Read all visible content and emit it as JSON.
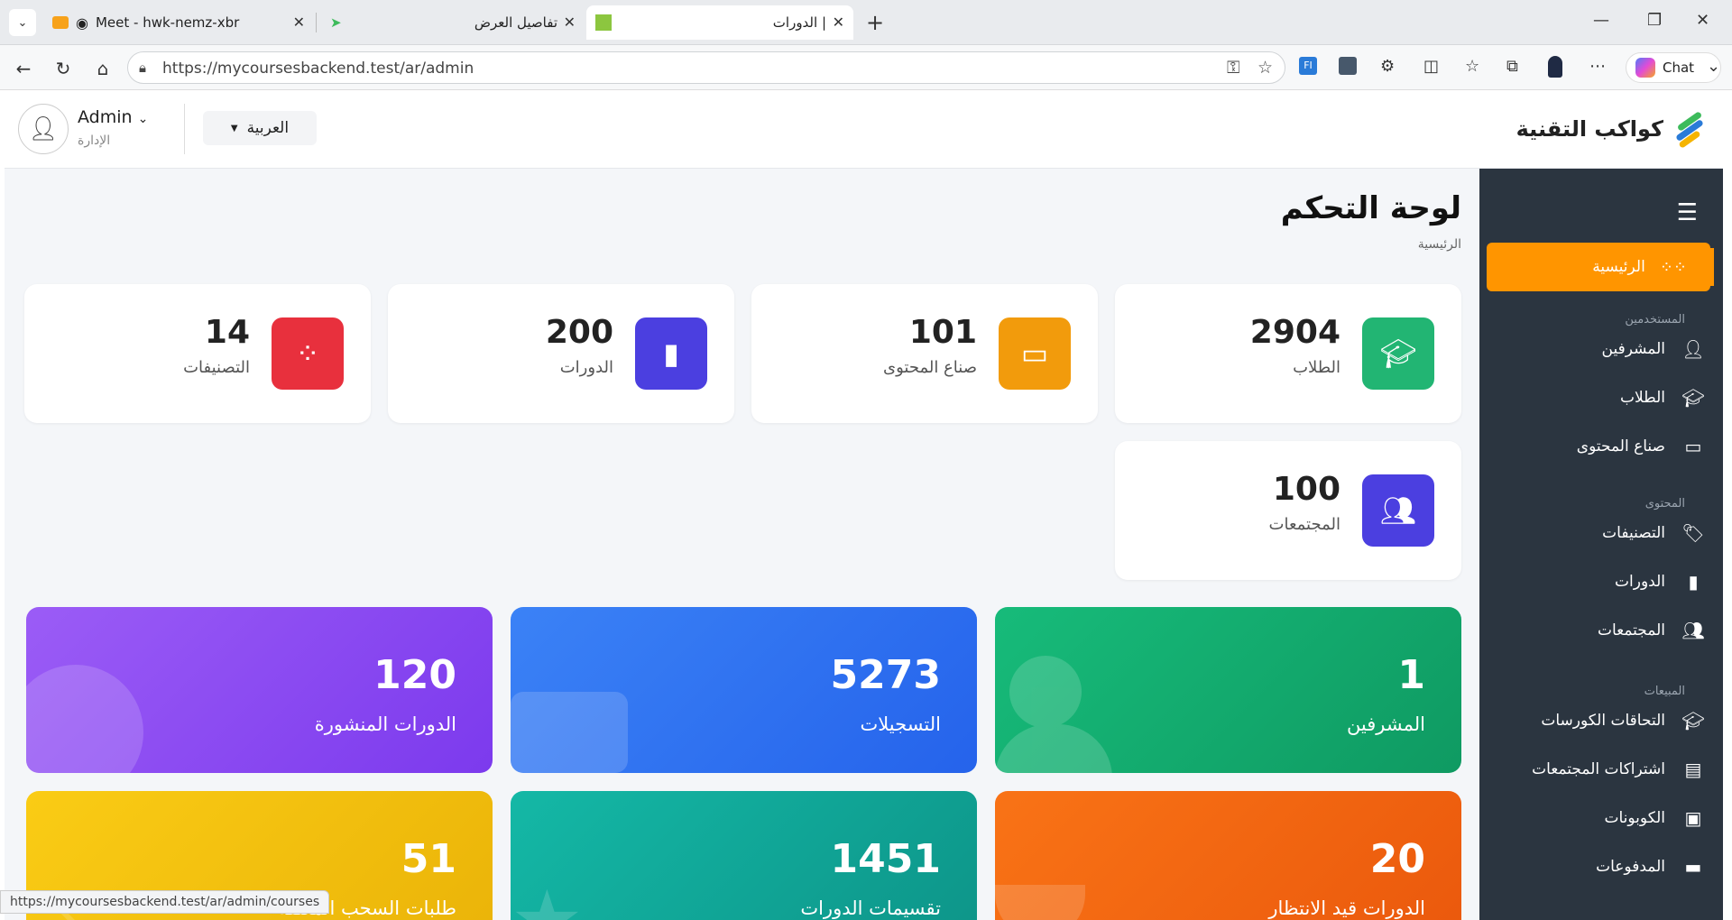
{
  "browser": {
    "tabs": [
      {
        "title": "Meet - hwk-nemz-xbr"
      },
      {
        "title": "تفاصيل العرض"
      },
      {
        "title": "الدورات |"
      }
    ],
    "url": "https://mycoursesbackend.test/ar/admin",
    "chat_label": "Chat",
    "status_url": "https://mycoursesbackend.test/ar/admin/courses"
  },
  "header": {
    "brand": "كواكب التقنية",
    "user_name": "Admin",
    "user_role": "الإدارة",
    "language": "العربية"
  },
  "sidebar": {
    "active": {
      "label": "الرئيسية",
      "icon": "grid-icon"
    },
    "sections": [
      {
        "title": "المستخدمين",
        "items": [
          {
            "label": "المشرفين",
            "icon": "user-shield-icon"
          },
          {
            "label": "الطلاب",
            "icon": "graduate-icon"
          },
          {
            "label": "صناع المحتوى",
            "icon": "teacher-icon"
          }
        ]
      },
      {
        "title": "المحتوى",
        "items": [
          {
            "label": "التصنيفات",
            "icon": "tags-icon"
          },
          {
            "label": "الدورات",
            "icon": "book-icon"
          },
          {
            "label": "المجتمعات",
            "icon": "people-icon"
          }
        ]
      },
      {
        "title": "المبيعات",
        "items": [
          {
            "label": "التحاقات الكورسات",
            "icon": "graduation-cap-icon"
          },
          {
            "label": "اشتراكات المجتمعات",
            "icon": "id-card-icon"
          },
          {
            "label": "الكوبونات",
            "icon": "ticket-icon"
          },
          {
            "label": "المدفوعات",
            "icon": "credit-card-icon"
          }
        ]
      }
    ]
  },
  "main": {
    "title": "لوحة التحكم",
    "breadcrumb": "الرئيسية",
    "stats": [
      {
        "value": "2904",
        "label": "الطلاب",
        "icon": "graduate-icon",
        "color": "#22b573"
      },
      {
        "value": "101",
        "label": "صناع المحتوى",
        "icon": "teacher-icon",
        "color": "#f29b0c"
      },
      {
        "value": "200",
        "label": "الدورات",
        "icon": "book-icon",
        "color": "#4b3fe0"
      },
      {
        "value": "14",
        "label": "التصنيفات",
        "icon": "grid-icon",
        "color": "#e8303d"
      },
      {
        "value": "100",
        "label": "المجتمعات",
        "icon": "people-icon",
        "color": "#4b3fe0"
      }
    ],
    "cards": [
      {
        "value": "1",
        "label": "المشرفين",
        "color": "#13a86d"
      },
      {
        "value": "5273",
        "label": "التسجيلات",
        "color": "#2f6ff0"
      },
      {
        "value": "120",
        "label": "الدورات المنشورة",
        "color": "#8a3fee"
      },
      {
        "value": "20",
        "label": "الدورات قيد الانتظار",
        "color": "#f06316"
      },
      {
        "value": "1451",
        "label": "تقسيمات الدورات",
        "color": "#13a898"
      },
      {
        "value": "51",
        "label": "طلبات السحب المعلقة",
        "color": "#f0b80c"
      }
    ]
  }
}
